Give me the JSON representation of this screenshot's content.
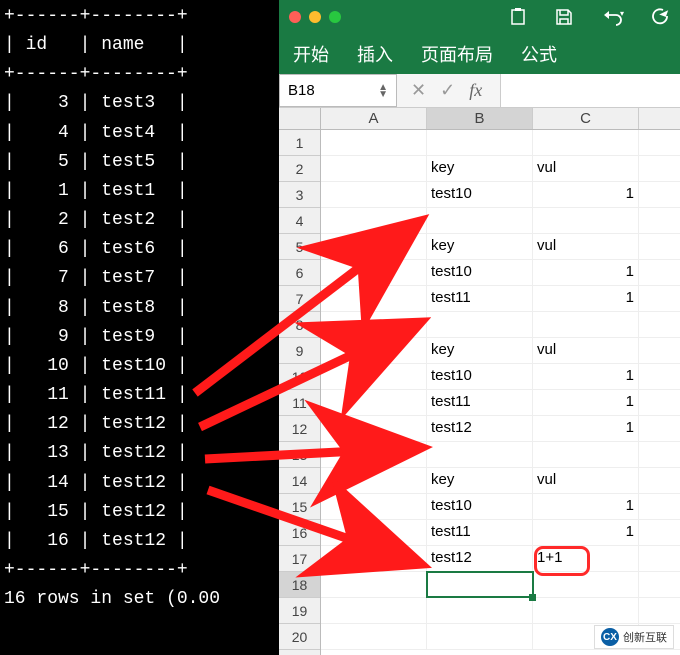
{
  "terminal": {
    "header_id": "id",
    "header_name": "name",
    "rows": [
      {
        "id": "3",
        "name": "test3"
      },
      {
        "id": "4",
        "name": "test4"
      },
      {
        "id": "5",
        "name": "test5"
      },
      {
        "id": "1",
        "name": "test1"
      },
      {
        "id": "2",
        "name": "test2"
      },
      {
        "id": "6",
        "name": "test6"
      },
      {
        "id": "7",
        "name": "test7"
      },
      {
        "id": "8",
        "name": "test8"
      },
      {
        "id": "9",
        "name": "test9"
      },
      {
        "id": "10",
        "name": "test10"
      },
      {
        "id": "11",
        "name": "test11"
      },
      {
        "id": "12",
        "name": "test12"
      },
      {
        "id": "13",
        "name": "test12"
      },
      {
        "id": "14",
        "name": "test12"
      },
      {
        "id": "15",
        "name": "test12"
      },
      {
        "id": "16",
        "name": "test12"
      }
    ],
    "footer": "16 rows in set (0.00"
  },
  "excel": {
    "tabs": [
      "开始",
      "插入",
      "页面布局",
      "公式"
    ],
    "namebox": "B18",
    "fx": "fx",
    "columns": [
      "A",
      "B",
      "C"
    ],
    "row_count": 20,
    "selected_row": 18,
    "selected_col": "B",
    "cells": {
      "2": {
        "B": "key",
        "C": "vul"
      },
      "3": {
        "B": "test10",
        "C": "1"
      },
      "5": {
        "B": "key",
        "C": "vul"
      },
      "6": {
        "B": "test10",
        "C": "1"
      },
      "7": {
        "B": "test11",
        "C": "1"
      },
      "9": {
        "B": "key",
        "C": "vul"
      },
      "10": {
        "B": "test10",
        "C": "1"
      },
      "11": {
        "B": "test11",
        "C": "1"
      },
      "12": {
        "B": "test12",
        "C": "1"
      },
      "14": {
        "B": "key",
        "C": "vul"
      },
      "15": {
        "B": "test10",
        "C": "1"
      },
      "16": {
        "B": "test11",
        "C": "1"
      },
      "17": {
        "B": "test12",
        "C": "1+1"
      }
    },
    "numeric_cells": [
      "3C",
      "6C",
      "7C",
      "10C",
      "11C",
      "12C",
      "15C",
      "16C"
    ]
  },
  "watermark": {
    "text": "创新互联",
    "logo": "CX"
  }
}
